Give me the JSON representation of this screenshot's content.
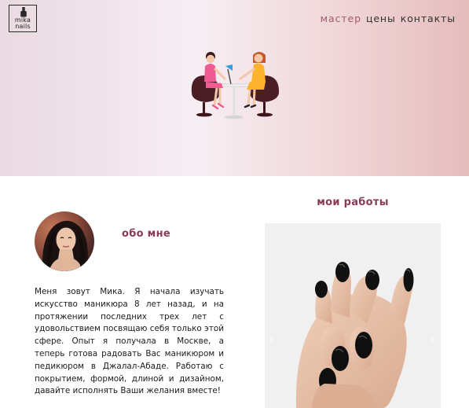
{
  "logo": {
    "line1": "mika",
    "line2": "nails"
  },
  "nav": {
    "items": [
      {
        "label": "мастер",
        "active": true
      },
      {
        "label": "цены",
        "active": false
      },
      {
        "label": "контакты",
        "active": false
      }
    ]
  },
  "about": {
    "title": "обо мне",
    "text": "Меня зовут Мика. Я начала изучать искусство маникюра 8 лет назад, и на протяжении последних трех лет с удовольствием посвящаю себя только этой сфере. Опыт я получала в Москве, а теперь готова радовать Вас маникюром и педикюром в Джалал-Абаде. Работаю с покрытием, формой, длиной и дизайном, давайте исполнять Ваши желания вместе!"
  },
  "works": {
    "title": "мои работы",
    "prev_label": "‹",
    "next_label": "›"
  },
  "icons": {
    "logo": "nail-polish-icon",
    "hero": "manicure-salon-illustration",
    "prev": "chevron-left-icon",
    "next": "chevron-right-icon"
  },
  "colors": {
    "accent": "#a5596f",
    "heading": "#8a3a57",
    "nail_polish": "#111111"
  }
}
